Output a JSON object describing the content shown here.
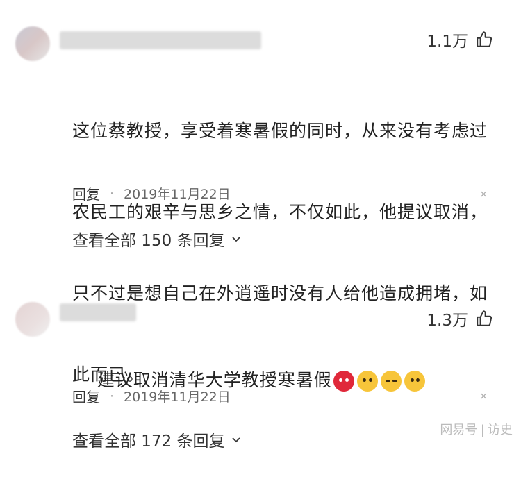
{
  "comments": [
    {
      "likes": "1.1万",
      "text_lines": [
        "这位蔡教授，享受着寒暑假的同时，从来没有考虑过",
        "农民工的艰辛与思乡之情，不仅如此，他提议取消，",
        "只不过是想自己在外逍遥时没有人给他造成拥堵，如",
        "此而已。"
      ],
      "reply_label": "回复",
      "separator": "·",
      "date": "2019年11月22日",
      "close": "×",
      "view_replies": "查看全部 150 条回复"
    },
    {
      "likes": "1.3万",
      "text": "建议取消清华大学教授寒暑假",
      "emojis": [
        "angry-red-emoji",
        "facepalm-emoji",
        "smug-emoji",
        "surprised-emoji"
      ],
      "reply_label": "回复",
      "separator": "·",
      "date": "2019年11月22日",
      "close": "×",
      "view_replies": "查看全部 172 条回复"
    }
  ],
  "watermark": "网易号 | 访史"
}
